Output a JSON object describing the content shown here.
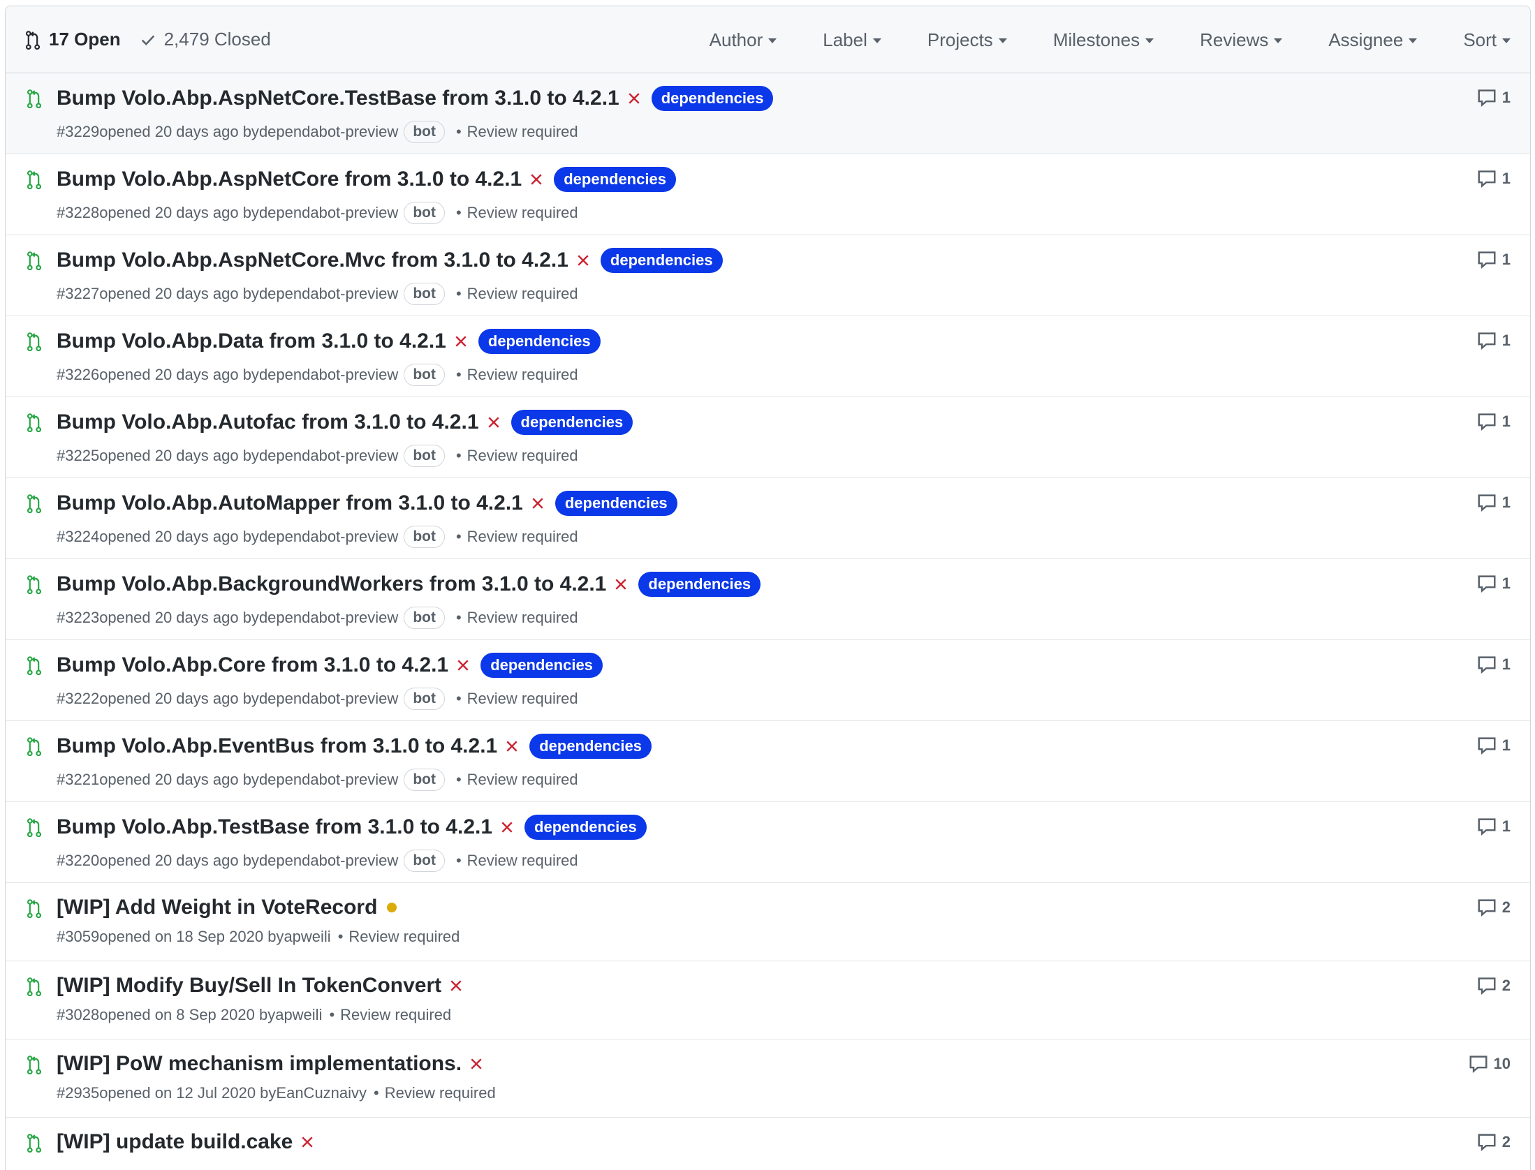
{
  "header": {
    "open_label": "17 Open",
    "closed_label": "2,479 Closed",
    "filters": [
      "Author",
      "Label",
      "Projects",
      "Milestones",
      "Reviews",
      "Assignee",
      "Sort"
    ]
  },
  "colors": {
    "open_green": "#28a745",
    "fail_red": "#cb2431",
    "pending_yellow": "#dbab09",
    "label_blue": "#0b38e8"
  },
  "pull_requests": [
    {
      "title": "Bump Volo.Abp.AspNetCore.TestBase from 3.1.0 to 4.2.1",
      "status": "failure",
      "label": "dependencies",
      "number": "#3229",
      "opened": "opened 20 days ago by",
      "author": "dependabot-preview",
      "bot": "bot",
      "review": "Review required",
      "comments": "1"
    },
    {
      "title": "Bump Volo.Abp.AspNetCore from 3.1.0 to 4.2.1",
      "status": "failure",
      "label": "dependencies",
      "number": "#3228",
      "opened": "opened 20 days ago by",
      "author": "dependabot-preview",
      "bot": "bot",
      "review": "Review required",
      "comments": "1"
    },
    {
      "title": "Bump Volo.Abp.AspNetCore.Mvc from 3.1.0 to 4.2.1",
      "status": "failure",
      "label": "dependencies",
      "number": "#3227",
      "opened": "opened 20 days ago by",
      "author": "dependabot-preview",
      "bot": "bot",
      "review": "Review required",
      "comments": "1"
    },
    {
      "title": "Bump Volo.Abp.Data from 3.1.0 to 4.2.1",
      "status": "failure",
      "label": "dependencies",
      "number": "#3226",
      "opened": "opened 20 days ago by",
      "author": "dependabot-preview",
      "bot": "bot",
      "review": "Review required",
      "comments": "1"
    },
    {
      "title": "Bump Volo.Abp.Autofac from 3.1.0 to 4.2.1",
      "status": "failure",
      "label": "dependencies",
      "number": "#3225",
      "opened": "opened 20 days ago by",
      "author": "dependabot-preview",
      "bot": "bot",
      "review": "Review required",
      "comments": "1"
    },
    {
      "title": "Bump Volo.Abp.AutoMapper from 3.1.0 to 4.2.1",
      "status": "failure",
      "label": "dependencies",
      "number": "#3224",
      "opened": "opened 20 days ago by",
      "author": "dependabot-preview",
      "bot": "bot",
      "review": "Review required",
      "comments": "1"
    },
    {
      "title": "Bump Volo.Abp.BackgroundWorkers from 3.1.0 to 4.2.1",
      "status": "failure",
      "label": "dependencies",
      "number": "#3223",
      "opened": "opened 20 days ago by",
      "author": "dependabot-preview",
      "bot": "bot",
      "review": "Review required",
      "comments": "1"
    },
    {
      "title": "Bump Volo.Abp.Core from 3.1.0 to 4.2.1",
      "status": "failure",
      "label": "dependencies",
      "number": "#3222",
      "opened": "opened 20 days ago by",
      "author": "dependabot-preview",
      "bot": "bot",
      "review": "Review required",
      "comments": "1"
    },
    {
      "title": "Bump Volo.Abp.EventBus from 3.1.0 to 4.2.1",
      "status": "failure",
      "label": "dependencies",
      "number": "#3221",
      "opened": "opened 20 days ago by",
      "author": "dependabot-preview",
      "bot": "bot",
      "review": "Review required",
      "comments": "1"
    },
    {
      "title": "Bump Volo.Abp.TestBase from 3.1.0 to 4.2.1",
      "status": "failure",
      "label": "dependencies",
      "number": "#3220",
      "opened": "opened 20 days ago by",
      "author": "dependabot-preview",
      "bot": "bot",
      "review": "Review required",
      "comments": "1"
    },
    {
      "title": "[WIP] Add Weight in VoteRecord",
      "status": "pending",
      "label": "",
      "number": "#3059",
      "opened": "opened on 18 Sep 2020 by",
      "author": "apweili",
      "bot": "",
      "review": "Review required",
      "comments": "2"
    },
    {
      "title": "[WIP] Modify Buy/Sell In TokenConvert",
      "status": "failure",
      "label": "",
      "number": "#3028",
      "opened": "opened on 8 Sep 2020 by",
      "author": "apweili",
      "bot": "",
      "review": "Review required",
      "comments": "2"
    },
    {
      "title": "[WIP] PoW mechanism implementations.",
      "status": "failure",
      "label": "",
      "number": "#2935",
      "opened": "opened on 12 Jul 2020 by",
      "author": "EanCuznaivy",
      "bot": "",
      "review": "Review required",
      "comments": "10"
    },
    {
      "title": "[WIP] update build.cake",
      "status": "failure",
      "label": "",
      "number": "",
      "opened": "",
      "author": "",
      "bot": "",
      "review": "",
      "comments": "2"
    }
  ]
}
